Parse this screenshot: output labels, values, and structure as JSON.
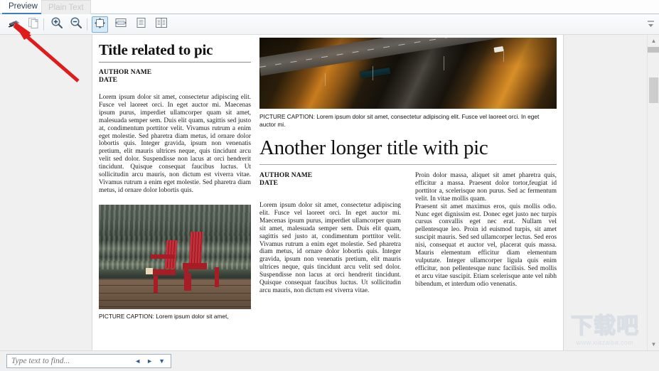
{
  "window": {
    "tabs": [
      {
        "label": "Preview",
        "active": true
      },
      {
        "label": "Plain Text",
        "active": false
      }
    ]
  },
  "toolbar": {
    "buttons": [
      {
        "name": "print",
        "label": "Print",
        "icon": "printer-icon",
        "selected": false
      },
      {
        "name": "copy",
        "label": "Copy",
        "icon": "copy-pages-icon",
        "selected": false
      },
      {
        "name": "zoom-in",
        "label": "Zoom In",
        "icon": "zoom-in-icon",
        "selected": false
      },
      {
        "name": "zoom-out",
        "label": "Zoom Out",
        "icon": "zoom-out-icon",
        "selected": false
      },
      {
        "name": "fit-page",
        "label": "Fit Page",
        "icon": "fit-page-icon",
        "selected": true
      },
      {
        "name": "fit-width",
        "label": "Fit Width",
        "icon": "fit-width-icon",
        "selected": false
      },
      {
        "name": "single-page",
        "label": "Single Page",
        "icon": "single-page-icon",
        "selected": false
      },
      {
        "name": "facing-pages",
        "label": "Facing Pages",
        "icon": "facing-pages-icon",
        "selected": false
      }
    ],
    "overflow_label": "More toolbar commands"
  },
  "document": {
    "article_one": {
      "title": "Title related to pic",
      "author": "AUTHOR NAME",
      "date": "DATE",
      "body": "Lorem ipsum dolor sit amet, consectetur adipiscing elit. Fusce vel laoreet orci. In eget auctor mi. Maecenas ipsum purus, imperdiet ullamcorper quam sit amet, malesuada semper sem. Duis elit quam, sagittis sed justo at, condimentum porttitor velit. Vivamus rutrum a enim eget molestie. Sed pharetra diam metus, id ornare dolor lobortis quis. Integer gravida, ipsum non venenatis pretium, elit mauris ultrices neque, quis tincidunt arcu velit sed dolor. Suspendisse non lacus at orci hendrerit tincidunt. Quisque consequat faucibus luctus. Ut sollicitudin arcu mauris, non dictum est viverra vitae. Vivamus rutrum a enim eget molestie. Sed pharetra diam metus, id ornare dolor lobortis quis.",
      "photo_alt": "Two red Adirondack chairs on a wooden dock beside rippling water",
      "caption": "PICTURE CAPTION: Lorem ipsum dolor sit amet,"
    },
    "article_two": {
      "title": "Another longer title with pic",
      "author": "AUTHOR NAME",
      "date": "DATE",
      "photo_alt": "Aerial view of a highway at sunset with a bus and autumn-colored trees",
      "caption": "PICTURE CAPTION: Lorem ipsum dolor sit amet, consectetur adipiscing elit. Fusce vel laoreet orci. In eget auctor mi.",
      "column_left": "Lorem ipsum dolor sit amet, consectetur adipiscing elit. Fusce vel laoreet orci. In eget auctor mi. Maecenas ipsum purus, imperdiet ullamcorper quam sit amet, malesuada semper sem. Duis elit quam, sagittis sed justo at, condimentum porttitor velit. Vivamus rutrum a enim eget molestie. Sed pharetra diam metus, id ornare dolor lobortis quis. Integer gravida, ipsum non venenatis pretium, elit mauris ultrices neque, quis tincidunt arcu velit sed dolor. Suspendisse non lacus at orci hendrerit tincidunt. Quisque consequat faucibus luctus. Ut sollicitudin arcu mauris, non dictum est viverra vitae.",
      "column_right_p1": "Proin dolor massa, aliquet sit amet pharetra quis, efficitur a massa. Praesent dolor tortor,feugiat id porttitor a, scelerisque non purus. Sed ac fermentum velit. In vitae mollis quam.",
      "column_right_p2": "Praesent sit amet maximus eros, quis mollis odio. Nunc eget dignissim est. Donec eget justo nec turpis cursus convallis eget nec erat. Nullam vel pellentesque leo. Proin id euismod turpis, sit amet suscipit mauris. Sed sed ullamcorper lectus. Sed eros nisi, consequat et auctor vel, placerat quis massa. Mauris elementum efficitur diam elementum vulputate. Integer ullamcorper ligula quis enim efficitur, non pellentesque nunc facilisis. Sed mollis et arcu vitae suscipit. Etiam scelerisque ante vel nibh bibendum, et interdum odio venenatis."
    }
  },
  "find": {
    "value": "",
    "placeholder": "Type text to find...",
    "prev_label": "◄",
    "next_label": "►",
    "options_label": "▼"
  },
  "watermark": {
    "text": "下载吧",
    "url": "www.xiazaiba.com"
  },
  "colors": {
    "accent": "#3f7fc1",
    "selected_button_bg": "#d6eaf8",
    "annotation_red": "#e01b1b"
  }
}
